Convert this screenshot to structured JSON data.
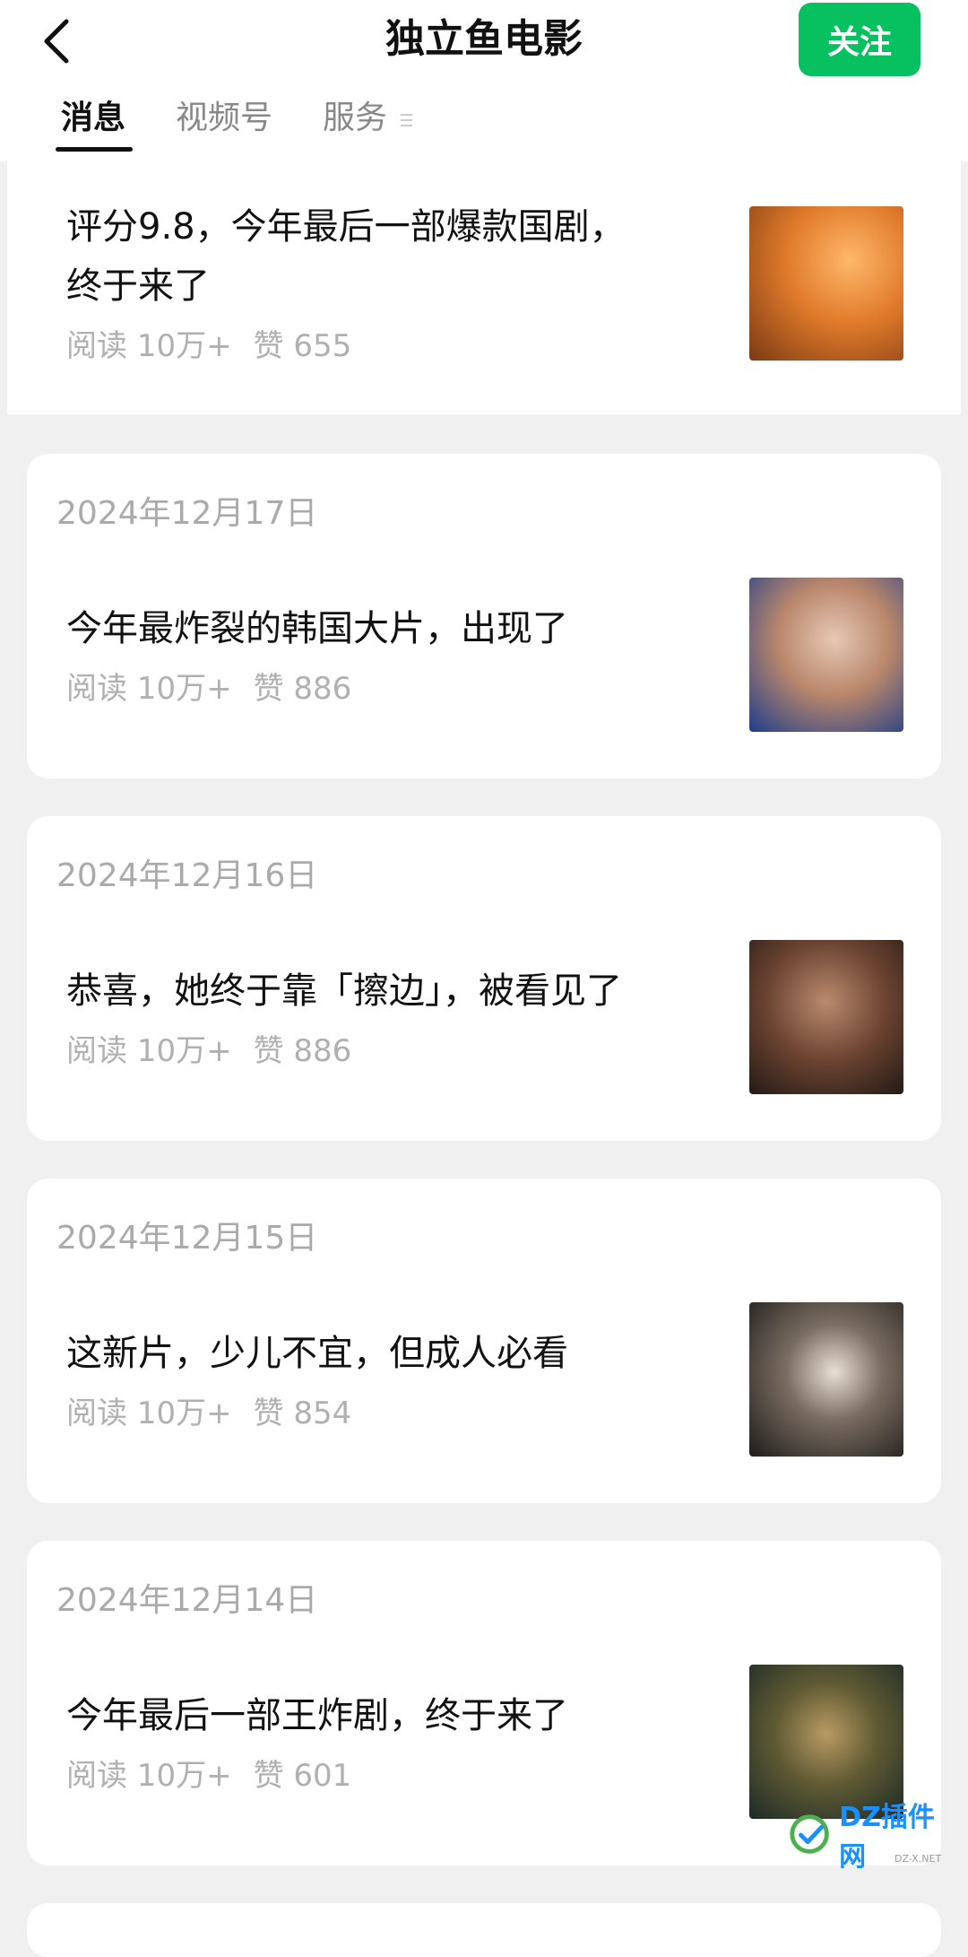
{
  "header": {
    "title": "独立鱼电影",
    "follow_label": "关注",
    "back_icon": "chevron-left-icon"
  },
  "tabs": [
    {
      "label": "消息",
      "active": true
    },
    {
      "label": "视频号",
      "active": false
    },
    {
      "label": "服务",
      "active": false
    }
  ],
  "articles": [
    {
      "date": "",
      "title_lines": [
        "评分9.8，今年最后一部爆款国剧，",
        "终于来了"
      ],
      "reads": "阅读 10万+",
      "likes": "赞 655"
    },
    {
      "date": "2024年12月17日",
      "title": "今年最炸裂的韩国大片，出现了",
      "reads": "阅读 10万+",
      "likes": "赞 886"
    },
    {
      "date": "2024年12月16日",
      "title": "恭喜，她终于靠「擦边」，被看见了",
      "reads": "阅读 10万+",
      "likes": "赞 886"
    },
    {
      "date": "2024年12月15日",
      "title": "这新片，少儿不宜，但成人必看",
      "reads": "阅读 10万+",
      "likes": "赞 854"
    },
    {
      "date": "2024年12月14日",
      "title": "今年最后一部王炸剧，终于来了",
      "reads": "阅读 10万+",
      "likes": "赞 601"
    }
  ],
  "watermark": {
    "text": "DZ插件网",
    "sub": "DZ-X.NET"
  },
  "colors": {
    "accent": "#07c160",
    "background": "#f0f0f0"
  }
}
